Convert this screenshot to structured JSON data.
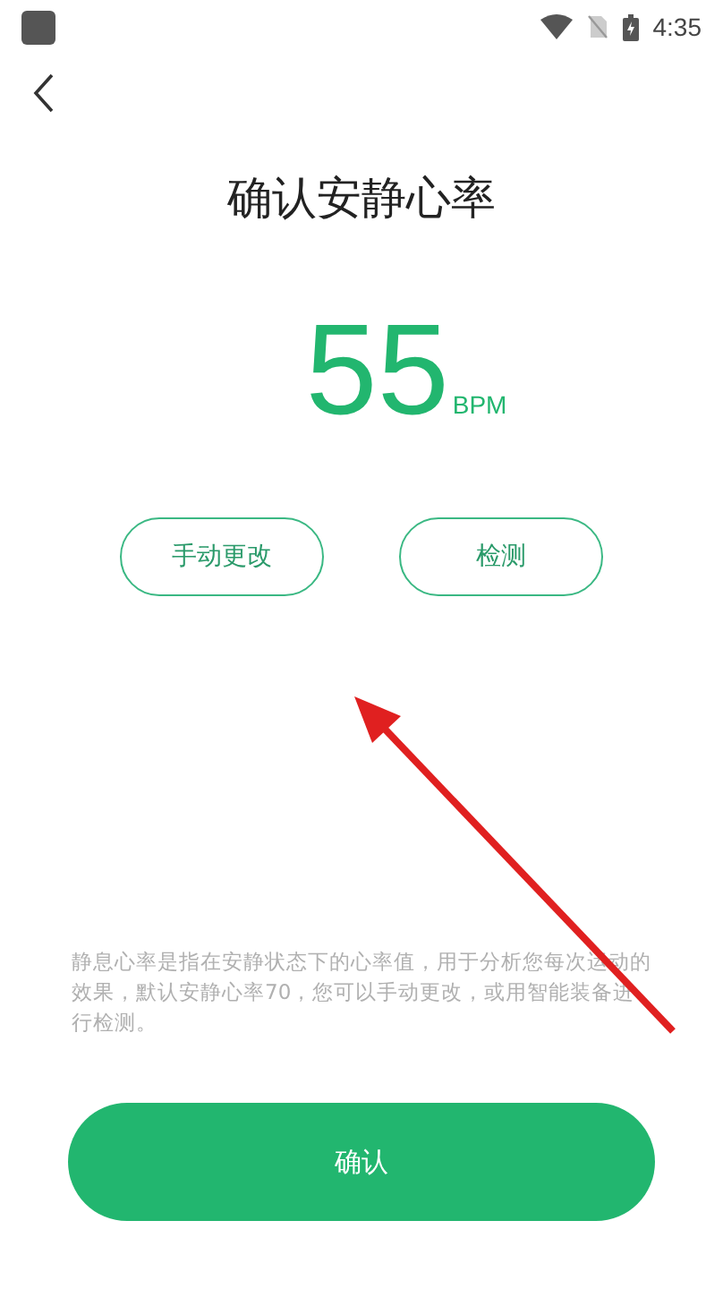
{
  "status_bar": {
    "time": "4:35"
  },
  "title": "确认安静心率",
  "heart_rate": {
    "value": "55",
    "unit": "BPM"
  },
  "buttons": [
    {
      "label": "手动更改"
    },
    {
      "label": "检测"
    }
  ],
  "description": "静息心率是指在安静状态下的心率值，用于分析您每次运动的效果，默认安静心率70，您可以手动更改，或用智能装备进行检测。",
  "confirm_button": "确认"
}
